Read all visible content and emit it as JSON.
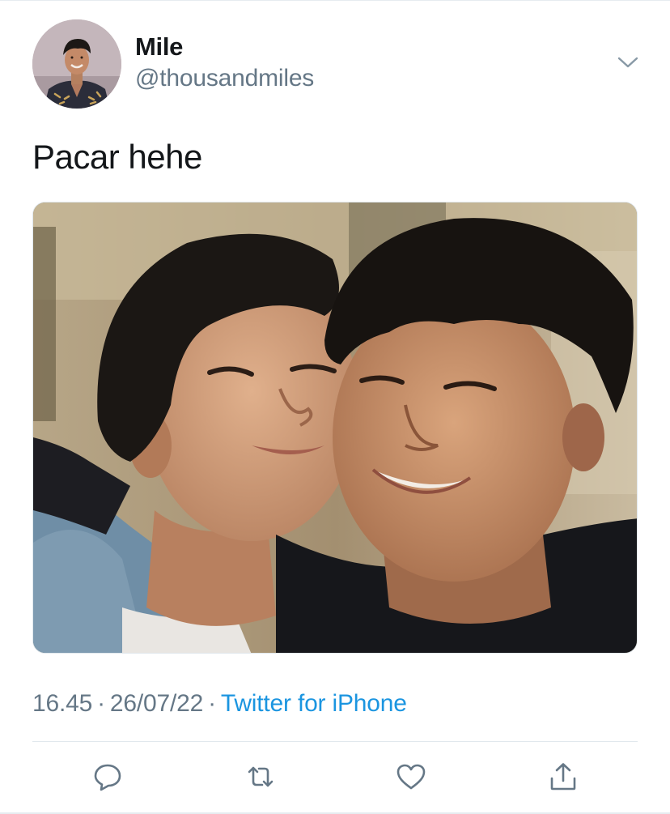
{
  "tweet": {
    "author": {
      "display_name": "Mile",
      "handle": "@thousandmiles",
      "avatar_icon": "profile-photo"
    },
    "text": "Pacar hehe",
    "media_icon": "photo-two-men-smiling",
    "meta": {
      "time": "16.45",
      "separator": "·",
      "date": "26/07/22",
      "source": "Twitter for iPhone"
    },
    "actions": [
      {
        "icon": "reply-icon"
      },
      {
        "icon": "retweet-icon"
      },
      {
        "icon": "like-icon"
      },
      {
        "icon": "share-icon"
      }
    ],
    "menu_icon": "chevron-down-icon"
  },
  "colors": {
    "text_primary": "#14171a",
    "text_secondary": "#657786",
    "link": "#1b95e0",
    "icon": "#657786",
    "divider": "#e1e8ed"
  }
}
